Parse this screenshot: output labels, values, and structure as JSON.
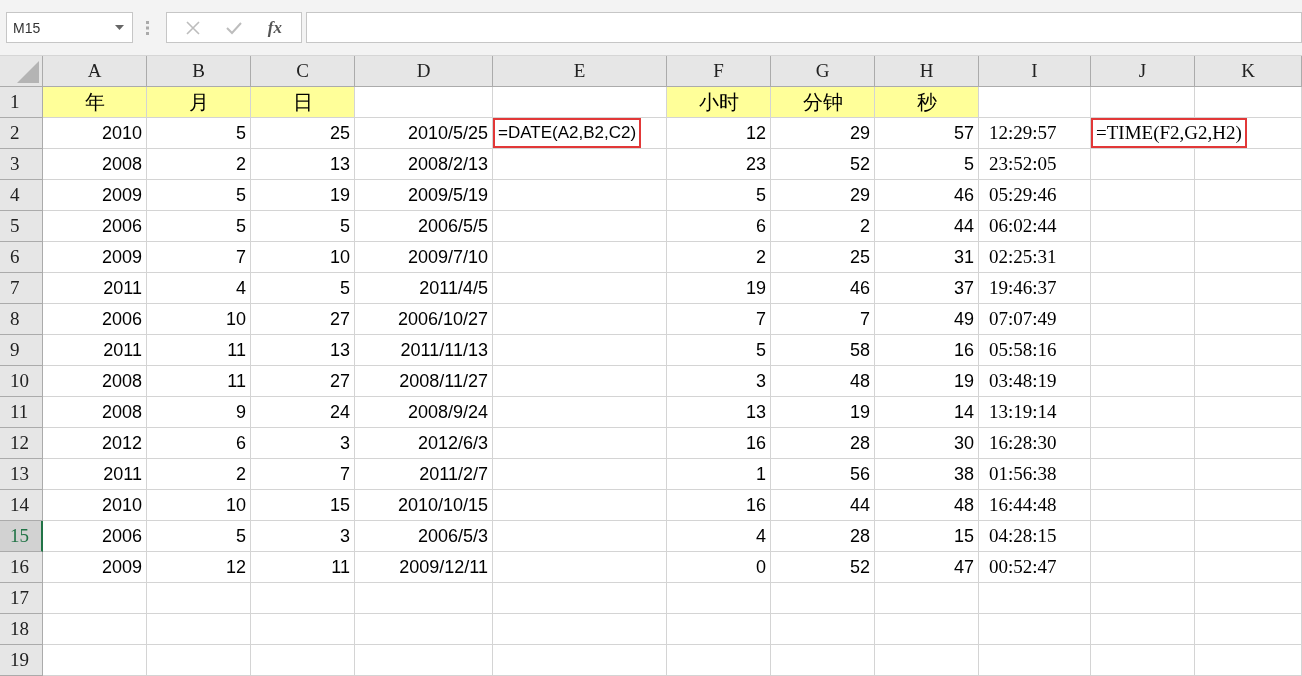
{
  "name_box": {
    "value": "M15"
  },
  "formula_bar": {
    "function_label": "fx",
    "cancel_disabled": true,
    "enter_disabled": true
  },
  "columns": [
    "A",
    "B",
    "C",
    "D",
    "E",
    "F",
    "G",
    "H",
    "I",
    "J",
    "K"
  ],
  "rows": [
    {
      "number": "1",
      "selected": false,
      "cells": [
        {
          "kind": "label",
          "text": "年"
        },
        {
          "kind": "label",
          "text": "月"
        },
        {
          "kind": "label",
          "text": "日"
        },
        {
          "kind": "blank"
        },
        {
          "kind": "blank"
        },
        {
          "kind": "label",
          "text": "小时"
        },
        {
          "kind": "label",
          "text": "分钟"
        },
        {
          "kind": "label",
          "text": "秒"
        },
        {
          "kind": "blank"
        },
        {
          "kind": "blank"
        },
        {
          "kind": "blank"
        }
      ]
    },
    {
      "number": "2",
      "selected": false,
      "cells": [
        {
          "kind": "number",
          "text": "2010"
        },
        {
          "kind": "number",
          "text": "5"
        },
        {
          "kind": "number",
          "text": "25"
        },
        {
          "kind": "number",
          "text": "2010/5/25"
        },
        {
          "kind": "formula",
          "text": "=DATE(A2,B2,C2)"
        },
        {
          "kind": "number",
          "text": "12"
        },
        {
          "kind": "number",
          "text": "29"
        },
        {
          "kind": "number",
          "text": "57"
        },
        {
          "kind": "time",
          "text": "12:29:57"
        },
        {
          "kind": "formula-serif",
          "text": "=TIME(F2,G2,H2)"
        },
        {
          "kind": "blank"
        }
      ]
    },
    {
      "number": "3",
      "selected": false,
      "cells": [
        {
          "kind": "number",
          "text": "2008"
        },
        {
          "kind": "number",
          "text": "2"
        },
        {
          "kind": "number",
          "text": "13"
        },
        {
          "kind": "number",
          "text": "2008/2/13"
        },
        {
          "kind": "blank"
        },
        {
          "kind": "number",
          "text": "23"
        },
        {
          "kind": "number",
          "text": "52"
        },
        {
          "kind": "number",
          "text": "5"
        },
        {
          "kind": "time",
          "text": "23:52:05"
        },
        {
          "kind": "blank"
        },
        {
          "kind": "blank"
        }
      ]
    },
    {
      "number": "4",
      "selected": false,
      "cells": [
        {
          "kind": "number",
          "text": "2009"
        },
        {
          "kind": "number",
          "text": "5"
        },
        {
          "kind": "number",
          "text": "19"
        },
        {
          "kind": "number",
          "text": "2009/5/19"
        },
        {
          "kind": "blank"
        },
        {
          "kind": "number",
          "text": "5"
        },
        {
          "kind": "number",
          "text": "29"
        },
        {
          "kind": "number",
          "text": "46"
        },
        {
          "kind": "time",
          "text": "05:29:46"
        },
        {
          "kind": "blank"
        },
        {
          "kind": "blank"
        }
      ]
    },
    {
      "number": "5",
      "selected": false,
      "cells": [
        {
          "kind": "number",
          "text": "2006"
        },
        {
          "kind": "number",
          "text": "5"
        },
        {
          "kind": "number",
          "text": "5"
        },
        {
          "kind": "number",
          "text": "2006/5/5"
        },
        {
          "kind": "blank"
        },
        {
          "kind": "number",
          "text": "6"
        },
        {
          "kind": "number",
          "text": "2"
        },
        {
          "kind": "number",
          "text": "44"
        },
        {
          "kind": "time",
          "text": "06:02:44"
        },
        {
          "kind": "blank"
        },
        {
          "kind": "blank"
        }
      ]
    },
    {
      "number": "6",
      "selected": false,
      "cells": [
        {
          "kind": "number",
          "text": "2009"
        },
        {
          "kind": "number",
          "text": "7"
        },
        {
          "kind": "number",
          "text": "10"
        },
        {
          "kind": "number",
          "text": "2009/7/10"
        },
        {
          "kind": "blank"
        },
        {
          "kind": "number",
          "text": "2"
        },
        {
          "kind": "number",
          "text": "25"
        },
        {
          "kind": "number",
          "text": "31"
        },
        {
          "kind": "time",
          "text": "02:25:31"
        },
        {
          "kind": "blank"
        },
        {
          "kind": "blank"
        }
      ]
    },
    {
      "number": "7",
      "selected": false,
      "cells": [
        {
          "kind": "number",
          "text": "2011"
        },
        {
          "kind": "number",
          "text": "4"
        },
        {
          "kind": "number",
          "text": "5"
        },
        {
          "kind": "number",
          "text": "2011/4/5"
        },
        {
          "kind": "blank"
        },
        {
          "kind": "number",
          "text": "19"
        },
        {
          "kind": "number",
          "text": "46"
        },
        {
          "kind": "number",
          "text": "37"
        },
        {
          "kind": "time",
          "text": "19:46:37"
        },
        {
          "kind": "blank"
        },
        {
          "kind": "blank"
        }
      ]
    },
    {
      "number": "8",
      "selected": false,
      "cells": [
        {
          "kind": "number",
          "text": "2006"
        },
        {
          "kind": "number",
          "text": "10"
        },
        {
          "kind": "number",
          "text": "27"
        },
        {
          "kind": "number",
          "text": "2006/10/27"
        },
        {
          "kind": "blank"
        },
        {
          "kind": "number",
          "text": "7"
        },
        {
          "kind": "number",
          "text": "7"
        },
        {
          "kind": "number",
          "text": "49"
        },
        {
          "kind": "time",
          "text": "07:07:49"
        },
        {
          "kind": "blank"
        },
        {
          "kind": "blank"
        }
      ]
    },
    {
      "number": "9",
      "selected": false,
      "cells": [
        {
          "kind": "number",
          "text": "2011"
        },
        {
          "kind": "number",
          "text": "11"
        },
        {
          "kind": "number",
          "text": "13"
        },
        {
          "kind": "number",
          "text": "2011/11/13"
        },
        {
          "kind": "blank"
        },
        {
          "kind": "number",
          "text": "5"
        },
        {
          "kind": "number",
          "text": "58"
        },
        {
          "kind": "number",
          "text": "16"
        },
        {
          "kind": "time",
          "text": "05:58:16"
        },
        {
          "kind": "blank"
        },
        {
          "kind": "blank"
        }
      ]
    },
    {
      "number": "10",
      "selected": false,
      "cells": [
        {
          "kind": "number",
          "text": "2008"
        },
        {
          "kind": "number",
          "text": "11"
        },
        {
          "kind": "number",
          "text": "27"
        },
        {
          "kind": "number",
          "text": "2008/11/27"
        },
        {
          "kind": "blank"
        },
        {
          "kind": "number",
          "text": "3"
        },
        {
          "kind": "number",
          "text": "48"
        },
        {
          "kind": "number",
          "text": "19"
        },
        {
          "kind": "time",
          "text": "03:48:19"
        },
        {
          "kind": "blank"
        },
        {
          "kind": "blank"
        }
      ]
    },
    {
      "number": "11",
      "selected": false,
      "cells": [
        {
          "kind": "number",
          "text": "2008"
        },
        {
          "kind": "number",
          "text": "9"
        },
        {
          "kind": "number",
          "text": "24"
        },
        {
          "kind": "number",
          "text": "2008/9/24"
        },
        {
          "kind": "blank"
        },
        {
          "kind": "number",
          "text": "13"
        },
        {
          "kind": "number",
          "text": "19"
        },
        {
          "kind": "number",
          "text": "14"
        },
        {
          "kind": "time",
          "text": "13:19:14"
        },
        {
          "kind": "blank"
        },
        {
          "kind": "blank"
        }
      ]
    },
    {
      "number": "12",
      "selected": false,
      "cells": [
        {
          "kind": "number",
          "text": "2012"
        },
        {
          "kind": "number",
          "text": "6"
        },
        {
          "kind": "number",
          "text": "3"
        },
        {
          "kind": "number",
          "text": "2012/6/3"
        },
        {
          "kind": "blank"
        },
        {
          "kind": "number",
          "text": "16"
        },
        {
          "kind": "number",
          "text": "28"
        },
        {
          "kind": "number",
          "text": "30"
        },
        {
          "kind": "time",
          "text": "16:28:30"
        },
        {
          "kind": "blank"
        },
        {
          "kind": "blank"
        }
      ]
    },
    {
      "number": "13",
      "selected": false,
      "cells": [
        {
          "kind": "number",
          "text": "2011"
        },
        {
          "kind": "number",
          "text": "2"
        },
        {
          "kind": "number",
          "text": "7"
        },
        {
          "kind": "number",
          "text": "2011/2/7"
        },
        {
          "kind": "blank"
        },
        {
          "kind": "number",
          "text": "1"
        },
        {
          "kind": "number",
          "text": "56"
        },
        {
          "kind": "number",
          "text": "38"
        },
        {
          "kind": "time",
          "text": "01:56:38"
        },
        {
          "kind": "blank"
        },
        {
          "kind": "blank"
        }
      ]
    },
    {
      "number": "14",
      "selected": false,
      "cells": [
        {
          "kind": "number",
          "text": "2010"
        },
        {
          "kind": "number",
          "text": "10"
        },
        {
          "kind": "number",
          "text": "15"
        },
        {
          "kind": "number",
          "text": "2010/10/15"
        },
        {
          "kind": "blank"
        },
        {
          "kind": "number",
          "text": "16"
        },
        {
          "kind": "number",
          "text": "44"
        },
        {
          "kind": "number",
          "text": "48"
        },
        {
          "kind": "time",
          "text": "16:44:48"
        },
        {
          "kind": "blank"
        },
        {
          "kind": "blank"
        }
      ]
    },
    {
      "number": "15",
      "selected": true,
      "cells": [
        {
          "kind": "number",
          "text": "2006"
        },
        {
          "kind": "number",
          "text": "5"
        },
        {
          "kind": "number",
          "text": "3"
        },
        {
          "kind": "number",
          "text": "2006/5/3"
        },
        {
          "kind": "blank"
        },
        {
          "kind": "number",
          "text": "4"
        },
        {
          "kind": "number",
          "text": "28"
        },
        {
          "kind": "number",
          "text": "15"
        },
        {
          "kind": "time",
          "text": "04:28:15"
        },
        {
          "kind": "blank"
        },
        {
          "kind": "blank"
        }
      ]
    },
    {
      "number": "16",
      "selected": false,
      "cells": [
        {
          "kind": "number",
          "text": "2009"
        },
        {
          "kind": "number",
          "text": "12"
        },
        {
          "kind": "number",
          "text": "11"
        },
        {
          "kind": "number",
          "text": "2009/12/11"
        },
        {
          "kind": "blank"
        },
        {
          "kind": "number",
          "text": "0"
        },
        {
          "kind": "number",
          "text": "52"
        },
        {
          "kind": "number",
          "text": "47"
        },
        {
          "kind": "time",
          "text": "00:52:47"
        },
        {
          "kind": "blank"
        },
        {
          "kind": "blank"
        }
      ]
    },
    {
      "number": "17",
      "selected": false,
      "cells": []
    },
    {
      "number": "18",
      "selected": false,
      "cells": []
    },
    {
      "number": "19",
      "selected": false,
      "cells": []
    }
  ]
}
